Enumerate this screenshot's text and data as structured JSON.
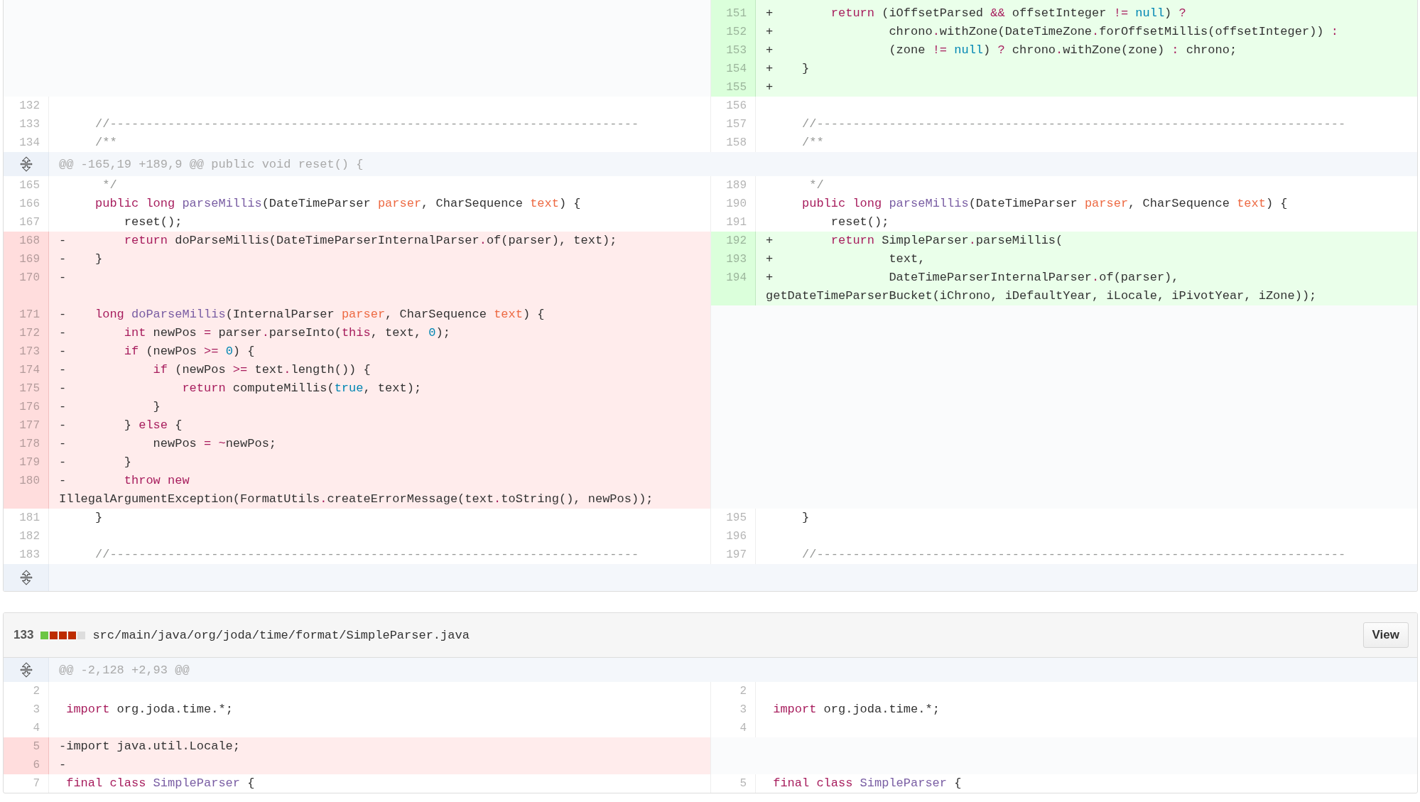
{
  "files": [
    {
      "rows": [
        {
          "kind": "line",
          "left": {
            "kind": "empty"
          },
          "right": {
            "kind": "add",
            "num": "151",
            "marker": "+",
            "code": [
              {
                "kind": "kw",
                "text": "        return"
              },
              {
                "kind": "p",
                "text": " (iOffsetParsed "
              },
              {
                "kind": "kw",
                "text": "&&"
              },
              {
                "kind": "p",
                "text": " offsetInteger "
              },
              {
                "kind": "kw",
                "text": "!="
              },
              {
                "kind": "c",
                "text": " null"
              },
              {
                "kind": "p",
                "text": ") "
              },
              {
                "kind": "kw",
                "text": "?"
              }
            ]
          }
        },
        {
          "kind": "line",
          "left": {
            "kind": "empty"
          },
          "right": {
            "kind": "add",
            "num": "152",
            "marker": "+",
            "code": [
              {
                "kind": "p",
                "text": "                chrono"
              },
              {
                "kind": "kw",
                "text": "."
              },
              {
                "kind": "p",
                "text": "withZone(DateTimeZone"
              },
              {
                "kind": "kw",
                "text": "."
              },
              {
                "kind": "p",
                "text": "forOffsetMillis(offsetInteger)) "
              },
              {
                "kind": "kw",
                "text": ":"
              }
            ]
          }
        },
        {
          "kind": "line",
          "left": {
            "kind": "empty"
          },
          "right": {
            "kind": "add",
            "num": "153",
            "marker": "+",
            "code": [
              {
                "kind": "p",
                "text": "                (zone "
              },
              {
                "kind": "kw",
                "text": "!="
              },
              {
                "kind": "c",
                "text": " null"
              },
              {
                "kind": "p",
                "text": ") "
              },
              {
                "kind": "kw",
                "text": "?"
              },
              {
                "kind": "p",
                "text": " chrono"
              },
              {
                "kind": "kw",
                "text": "."
              },
              {
                "kind": "p",
                "text": "withZone(zone) "
              },
              {
                "kind": "kw",
                "text": ":"
              },
              {
                "kind": "p",
                "text": " chrono;"
              }
            ]
          }
        },
        {
          "kind": "line",
          "left": {
            "kind": "empty"
          },
          "right": {
            "kind": "add",
            "num": "154",
            "marker": "+",
            "code": [
              {
                "kind": "p",
                "text": "    }"
              }
            ]
          }
        },
        {
          "kind": "line",
          "left": {
            "kind": "empty"
          },
          "right": {
            "kind": "add",
            "num": "155",
            "marker": "+"
          }
        },
        {
          "kind": "line",
          "left": {
            "kind": "ctx",
            "num": "132"
          },
          "right": {
            "kind": "ctx",
            "num": "156"
          }
        },
        {
          "kind": "line",
          "left": {
            "kind": "ctx",
            "num": "133",
            "code": [
              {
                "kind": "cm",
                "text": "    //-------------------------------------------------------------------------"
              }
            ]
          },
          "right": {
            "kind": "ctx",
            "num": "157",
            "code": [
              {
                "kind": "cm",
                "text": "    //-------------------------------------------------------------------------"
              }
            ]
          }
        },
        {
          "kind": "line",
          "left": {
            "kind": "ctx",
            "num": "134",
            "code": [
              {
                "kind": "cm",
                "text": "    /**"
              }
            ]
          },
          "right": {
            "kind": "ctx",
            "num": "158",
            "code": [
              {
                "kind": "cm",
                "text": "    /**"
              }
            ]
          }
        },
        {
          "kind": "hunk",
          "text": "@@ -165,19 +189,9 @@ public void reset() {"
        },
        {
          "kind": "line",
          "left": {
            "kind": "ctx",
            "num": "165",
            "code": [
              {
                "kind": "cm",
                "text": "     */"
              }
            ]
          },
          "right": {
            "kind": "ctx",
            "num": "189",
            "code": [
              {
                "kind": "cm",
                "text": "     */"
              }
            ]
          }
        },
        {
          "kind": "line",
          "left": {
            "kind": "ctx",
            "num": "166",
            "code": [
              {
                "kind": "kw",
                "text": "    public long"
              },
              {
                "kind": "fn",
                "text": " parseMillis"
              },
              {
                "kind": "p",
                "text": "(DateTimeParser "
              },
              {
                "kind": "pa",
                "text": "parser"
              },
              {
                "kind": "p",
                "text": ", CharSequence "
              },
              {
                "kind": "pa",
                "text": "text"
              },
              {
                "kind": "p",
                "text": ") {"
              }
            ]
          },
          "right": {
            "kind": "ctx",
            "num": "190",
            "code": [
              {
                "kind": "kw",
                "text": "    public long"
              },
              {
                "kind": "fn",
                "text": " parseMillis"
              },
              {
                "kind": "p",
                "text": "(DateTimeParser "
              },
              {
                "kind": "pa",
                "text": "parser"
              },
              {
                "kind": "p",
                "text": ", CharSequence "
              },
              {
                "kind": "pa",
                "text": "text"
              },
              {
                "kind": "p",
                "text": ") {"
              }
            ]
          }
        },
        {
          "kind": "line",
          "left": {
            "kind": "ctx",
            "num": "167",
            "code": [
              {
                "kind": "p",
                "text": "        reset();"
              }
            ]
          },
          "right": {
            "kind": "ctx",
            "num": "191",
            "code": [
              {
                "kind": "p",
                "text": "        reset();"
              }
            ]
          }
        },
        {
          "kind": "line",
          "left": {
            "kind": "del",
            "num": "168",
            "marker": "-",
            "code": [
              {
                "kind": "kw",
                "text": "        return"
              },
              {
                "kind": "p",
                "text": " doParseMillis(DateTimeParserInternalParser"
              },
              {
                "kind": "kw",
                "text": "."
              },
              {
                "kind": "p",
                "text": "of(parser), text);"
              }
            ]
          },
          "right": {
            "kind": "add",
            "num": "192",
            "marker": "+",
            "code": [
              {
                "kind": "kw",
                "text": "        return"
              },
              {
                "kind": "p",
                "text": " SimpleParser"
              },
              {
                "kind": "kw",
                "text": "."
              },
              {
                "kind": "p",
                "text": "parseMillis("
              }
            ]
          }
        },
        {
          "kind": "line",
          "left": {
            "kind": "del",
            "num": "169",
            "marker": "-",
            "code": [
              {
                "kind": "p",
                "text": "    }"
              }
            ]
          },
          "right": {
            "kind": "add",
            "num": "193",
            "marker": "+",
            "code": [
              {
                "kind": "p",
                "text": "                text,"
              }
            ]
          }
        },
        {
          "kind": "line",
          "left": {
            "kind": "del",
            "num": "170",
            "marker": "-"
          },
          "right": {
            "kind": "add",
            "num": "194",
            "marker": "+",
            "code": [
              {
                "kind": "p",
                "text": "                DateTimeParserInternalParser"
              },
              {
                "kind": "kw",
                "text": "."
              },
              {
                "kind": "p",
                "text": "of(parser),"
              }
            ],
            "wrap": [
              {
                "kind": "p",
                "text": "getDateTimeParserBucket(iChrono, iDefaultYear, iLocale, iPivotYear, iZone));"
              }
            ]
          }
        },
        {
          "kind": "line",
          "left": {
            "kind": "del",
            "num": "171",
            "marker": "-",
            "code": [
              {
                "kind": "kw",
                "text": "    long"
              },
              {
                "kind": "fn",
                "text": " doParseMillis"
              },
              {
                "kind": "p",
                "text": "(InternalParser "
              },
              {
                "kind": "pa",
                "text": "parser"
              },
              {
                "kind": "p",
                "text": ", CharSequence "
              },
              {
                "kind": "pa",
                "text": "text"
              },
              {
                "kind": "p",
                "text": ") {"
              }
            ]
          },
          "right": {
            "kind": "empty"
          }
        },
        {
          "kind": "line",
          "left": {
            "kind": "del",
            "num": "172",
            "marker": "-",
            "code": [
              {
                "kind": "kw",
                "text": "        int"
              },
              {
                "kind": "p",
                "text": " newPos "
              },
              {
                "kind": "kw",
                "text": "="
              },
              {
                "kind": "p",
                "text": " parser"
              },
              {
                "kind": "kw",
                "text": "."
              },
              {
                "kind": "p",
                "text": "parseInto("
              },
              {
                "kind": "kw",
                "text": "this"
              },
              {
                "kind": "p",
                "text": ", text, "
              },
              {
                "kind": "c",
                "text": "0"
              },
              {
                "kind": "p",
                "text": ");"
              }
            ]
          },
          "right": {
            "kind": "empty"
          }
        },
        {
          "kind": "line",
          "left": {
            "kind": "del",
            "num": "173",
            "marker": "-",
            "code": [
              {
                "kind": "kw",
                "text": "        if"
              },
              {
                "kind": "p",
                "text": " (newPos "
              },
              {
                "kind": "kw",
                "text": ">="
              },
              {
                "kind": "c",
                "text": " 0"
              },
              {
                "kind": "p",
                "text": ") {"
              }
            ]
          },
          "right": {
            "kind": "empty"
          }
        },
        {
          "kind": "line",
          "left": {
            "kind": "del",
            "num": "174",
            "marker": "-",
            "code": [
              {
                "kind": "kw",
                "text": "            if"
              },
              {
                "kind": "p",
                "text": " (newPos "
              },
              {
                "kind": "kw",
                "text": ">="
              },
              {
                "kind": "p",
                "text": " text"
              },
              {
                "kind": "kw",
                "text": "."
              },
              {
                "kind": "p",
                "text": "length()) {"
              }
            ]
          },
          "right": {
            "kind": "empty"
          }
        },
        {
          "kind": "line",
          "left": {
            "kind": "del",
            "num": "175",
            "marker": "-",
            "code": [
              {
                "kind": "kw",
                "text": "                return"
              },
              {
                "kind": "p",
                "text": " computeMillis("
              },
              {
                "kind": "c",
                "text": "true"
              },
              {
                "kind": "p",
                "text": ", text);"
              }
            ]
          },
          "right": {
            "kind": "empty"
          }
        },
        {
          "kind": "line",
          "left": {
            "kind": "del",
            "num": "176",
            "marker": "-",
            "code": [
              {
                "kind": "p",
                "text": "            }"
              }
            ]
          },
          "right": {
            "kind": "empty"
          }
        },
        {
          "kind": "line",
          "left": {
            "kind": "del",
            "num": "177",
            "marker": "-",
            "code": [
              {
                "kind": "p",
                "text": "        } "
              },
              {
                "kind": "kw",
                "text": "else"
              },
              {
                "kind": "p",
                "text": " {"
              }
            ]
          },
          "right": {
            "kind": "empty"
          }
        },
        {
          "kind": "line",
          "left": {
            "kind": "del",
            "num": "178",
            "marker": "-",
            "code": [
              {
                "kind": "p",
                "text": "            newPos "
              },
              {
                "kind": "kw",
                "text": "= ~"
              },
              {
                "kind": "p",
                "text": "newPos;"
              }
            ]
          },
          "right": {
            "kind": "empty"
          }
        },
        {
          "kind": "line",
          "left": {
            "kind": "del",
            "num": "179",
            "marker": "-",
            "code": [
              {
                "kind": "p",
                "text": "        }"
              }
            ]
          },
          "right": {
            "kind": "empty"
          }
        },
        {
          "kind": "line",
          "left": {
            "kind": "del",
            "num": "180",
            "marker": "-",
            "code": [
              {
                "kind": "kw",
                "text": "        throw new"
              }
            ],
            "wrap": [
              {
                "kind": "p",
                "text": "IllegalArgumentException(FormatUtils"
              },
              {
                "kind": "kw",
                "text": "."
              },
              {
                "kind": "p",
                "text": "createErrorMessage(text"
              },
              {
                "kind": "kw",
                "text": "."
              },
              {
                "kind": "p",
                "text": "toString(), newPos));"
              }
            ]
          },
          "right": {
            "kind": "empty"
          }
        },
        {
          "kind": "line",
          "left": {
            "kind": "ctx",
            "num": "181",
            "code": [
              {
                "kind": "p",
                "text": "    }"
              }
            ]
          },
          "right": {
            "kind": "ctx",
            "num": "195",
            "code": [
              {
                "kind": "p",
                "text": "    }"
              }
            ]
          }
        },
        {
          "kind": "line",
          "left": {
            "kind": "ctx",
            "num": "182"
          },
          "right": {
            "kind": "ctx",
            "num": "196"
          }
        },
        {
          "kind": "line",
          "left": {
            "kind": "ctx",
            "num": "183",
            "code": [
              {
                "kind": "cm",
                "text": "    //-------------------------------------------------------------------------"
              }
            ]
          },
          "right": {
            "kind": "ctx",
            "num": "197",
            "code": [
              {
                "kind": "cm",
                "text": "    //-------------------------------------------------------------------------"
              }
            ]
          }
        },
        {
          "kind": "expand"
        }
      ]
    },
    {
      "header": {
        "changes": "133",
        "stat": [
          {
            "kind": "add"
          },
          {
            "kind": "del"
          },
          {
            "kind": "del"
          },
          {
            "kind": "del"
          },
          {
            "kind": "neutral"
          }
        ],
        "path": "src/main/java/org/joda/time/format/SimpleParser.java",
        "button": "View"
      },
      "rows": [
        {
          "kind": "hunk",
          "text": "@@ -2,128 +2,93 @@"
        },
        {
          "kind": "line",
          "left": {
            "kind": "ctx",
            "num": "2"
          },
          "right": {
            "kind": "ctx",
            "num": "2"
          }
        },
        {
          "kind": "line",
          "left": {
            "kind": "ctx",
            "num": "3",
            "code": [
              {
                "kind": "kw",
                "text": "import"
              },
              {
                "kind": "p",
                "text": " org.joda.time.*;"
              }
            ]
          },
          "right": {
            "kind": "ctx",
            "num": "3",
            "code": [
              {
                "kind": "kw",
                "text": "import"
              },
              {
                "kind": "p",
                "text": " org.joda.time.*;"
              }
            ]
          }
        },
        {
          "kind": "line",
          "left": {
            "kind": "ctx",
            "num": "4"
          },
          "right": {
            "kind": "ctx",
            "num": "4"
          }
        },
        {
          "kind": "line",
          "left": {
            "kind": "del",
            "num": "5",
            "marker": "-",
            "code": [
              {
                "kind": "p",
                "text": "import java.util.Locale;"
              }
            ]
          },
          "right": {
            "kind": "empty"
          }
        },
        {
          "kind": "line",
          "left": {
            "kind": "del",
            "num": "6",
            "marker": "-"
          },
          "right": {
            "kind": "empty"
          }
        },
        {
          "kind": "line",
          "left": {
            "kind": "ctx",
            "num": "7",
            "code": [
              {
                "kind": "kw",
                "text": "final class"
              },
              {
                "kind": "fn",
                "text": " SimpleParser"
              },
              {
                "kind": "p",
                "text": " {"
              }
            ]
          },
          "right": {
            "kind": "ctx",
            "num": "5",
            "code": [
              {
                "kind": "kw",
                "text": "final class"
              },
              {
                "kind": "fn",
                "text": " SimpleParser"
              },
              {
                "kind": "p",
                "text": " {"
              }
            ]
          }
        }
      ]
    }
  ]
}
